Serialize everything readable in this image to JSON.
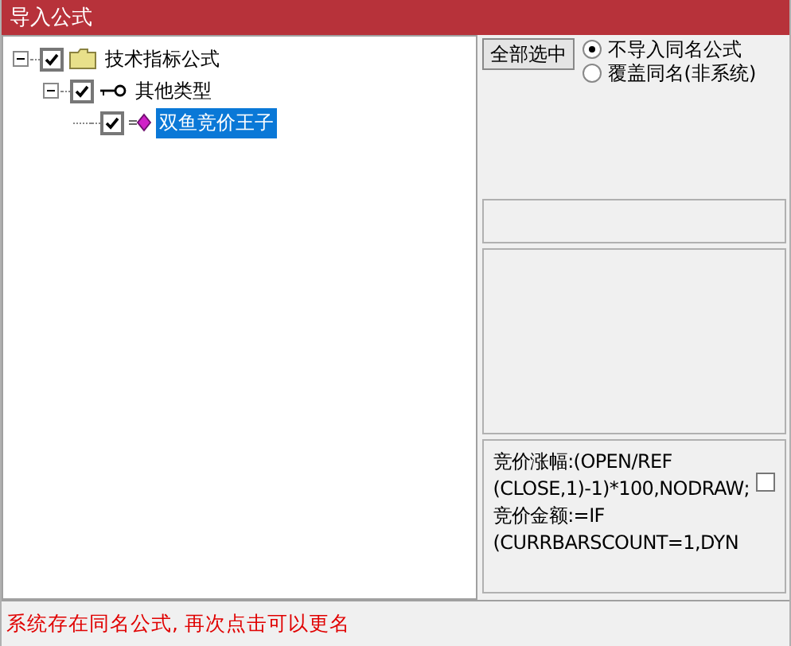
{
  "window": {
    "title": "导入公式"
  },
  "tree": [
    {
      "label": "技术指标公式",
      "kind": "folder",
      "checked": true,
      "expanded": true,
      "selected": false,
      "children": [
        {
          "label": "其他类型",
          "kind": "key",
          "checked": true,
          "expanded": true,
          "selected": false,
          "children": [
            {
              "label": "双鱼竞价王子",
              "kind": "formula",
              "checked": true,
              "selected": true
            }
          ]
        }
      ]
    }
  ],
  "select_all_button": "全部选中",
  "options": [
    {
      "label": "不导入同名公式",
      "selected": true
    },
    {
      "label": "覆盖同名(非系统)",
      "selected": false
    }
  ],
  "formula_preview": {
    "lines": [
      "竞价涨幅:(OPEN/REF",
      "(CLOSE,1)-1)*100,NODRAW;",
      "竞价金额:=IF",
      "(CURRBARSCOUNT=1,DYN"
    ],
    "checked": false
  },
  "status_message": "系统存在同名公式, 再次点击可以更名"
}
